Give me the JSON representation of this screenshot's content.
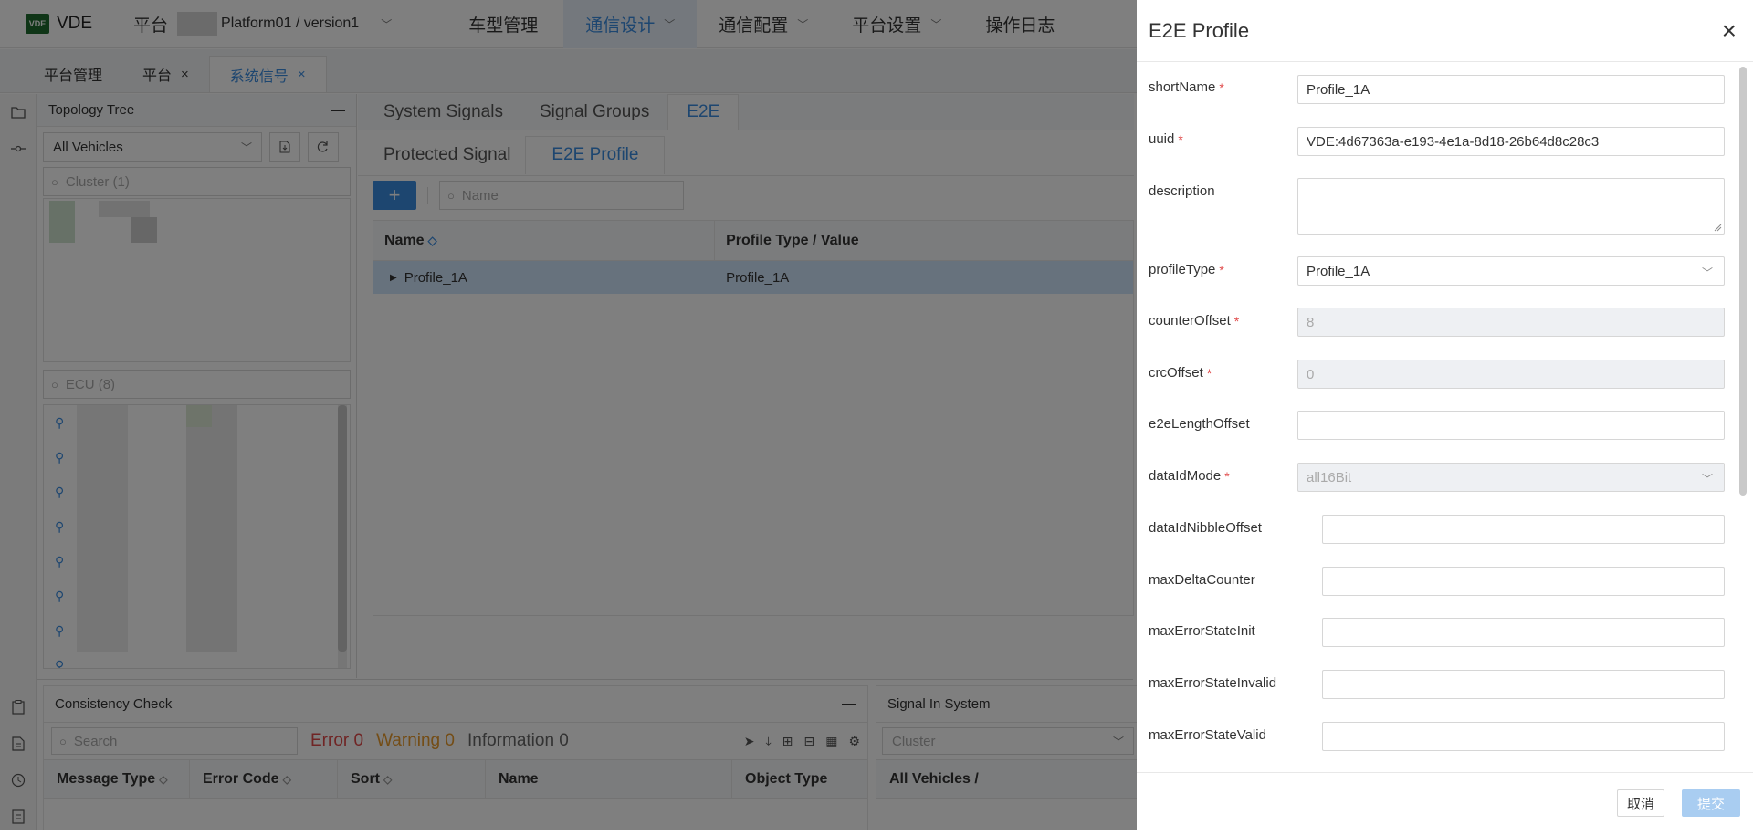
{
  "header": {
    "logo_mark": "VDE",
    "app_name": "VDE",
    "platform_label": "平台",
    "platform_version": "Platform01 / version1",
    "nav": [
      {
        "label": "车型管理"
      },
      {
        "label": "通信设计"
      },
      {
        "label": "通信配置"
      },
      {
        "label": "平台设置"
      },
      {
        "label": "操作日志"
      }
    ]
  },
  "page_tabs": [
    {
      "label": "平台管理"
    },
    {
      "label": "平台",
      "close": "×"
    },
    {
      "label": "系统信号",
      "close": "×"
    }
  ],
  "topology": {
    "title": "Topology Tree",
    "vehicle_select": "All Vehicles",
    "cluster_search": "Cluster (1)",
    "ecu_search": "ECU (8)"
  },
  "main": {
    "tabs": [
      {
        "label": "System Signals"
      },
      {
        "label": "Signal Groups"
      },
      {
        "label": "E2E"
      }
    ],
    "subtabs": [
      {
        "label": "Protected Signal"
      },
      {
        "label": "E2E Profile"
      }
    ],
    "add_label": "+",
    "search_placeholder": "Name",
    "columns": [
      "Name",
      "Profile Type / Value"
    ],
    "rows": [
      {
        "name": "Profile_1A",
        "type": "Profile_1A"
      }
    ]
  },
  "consistency": {
    "title": "Consistency Check",
    "search_placeholder": "Search",
    "error": "Error 0",
    "warning": "Warning 0",
    "information": "Information 0",
    "columns": [
      "Message Type",
      "Error Code",
      "Sort",
      "Name",
      "Object Type"
    ]
  },
  "signal_in_system": {
    "title": "Signal In System",
    "select": "Cluster",
    "column": "All Vehicles /"
  },
  "drawer": {
    "title": "E2E Profile",
    "close": "×",
    "fields": {
      "shortName": {
        "label": "shortName",
        "value": "Profile_1A",
        "required": "*"
      },
      "uuid": {
        "label": "uuid",
        "value": "VDE:4d67363a-e193-4e1a-8d18-26b64d8c28c3",
        "required": "*"
      },
      "description": {
        "label": "description",
        "value": ""
      },
      "profileType": {
        "label": "profileType",
        "value": "Profile_1A",
        "required": "*"
      },
      "counterOffset": {
        "label": "counterOffset",
        "value": "8",
        "required": "*"
      },
      "crcOffset": {
        "label": "crcOffset",
        "value": "0",
        "required": "*"
      },
      "e2eLengthOffset": {
        "label": "e2eLengthOffset",
        "value": ""
      },
      "dataIdMode": {
        "label": "dataIdMode",
        "value": "all16Bit",
        "required": "*"
      },
      "dataIdNibbleOffset": {
        "label": "dataIdNibbleOffset",
        "value": ""
      },
      "maxDeltaCounter": {
        "label": "maxDeltaCounter",
        "value": ""
      },
      "maxErrorStateInit": {
        "label": "maxErrorStateInit",
        "value": ""
      },
      "maxErrorStateInvalid": {
        "label": "maxErrorStateInvalid",
        "value": ""
      },
      "maxErrorStateValid": {
        "label": "maxErrorStateValid",
        "value": ""
      }
    },
    "cancel": "取消",
    "submit": "提交"
  },
  "colors": {
    "accent": "#3b8ce0",
    "required": "#e04a4a",
    "error": "#e04a4a",
    "warning": "#e89a2c",
    "selected_row": "#cfe4fb"
  },
  "icons": [
    "folder-icon",
    "topology-icon",
    "search-icon",
    "export-icon",
    "refresh-icon",
    "ecu-icon",
    "close-icon",
    "chevron-down-icon",
    "sort-icon",
    "caret-right-icon"
  ]
}
